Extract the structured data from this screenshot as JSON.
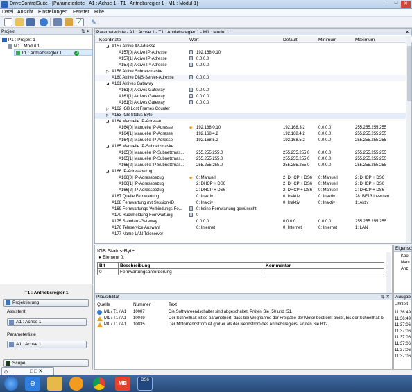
{
  "window": {
    "title": "DriveControlSuite  -  [Parameterliste - A1 : Achse 1 - T1 : Antriebsregler 1 - M1 : Modul 1]"
  },
  "menu": [
    "Datei",
    "Ansicht",
    "Einstellungen",
    "Fenster",
    "Hilfe"
  ],
  "toolbar": {
    "icons": [
      "new-file-icon",
      "open-folder-icon",
      "save-icon",
      "info-icon",
      "network-icon",
      "print-icon",
      "check-icon",
      "pen-icon"
    ]
  },
  "project_panel": {
    "title": "Projekt",
    "tree": [
      {
        "label": "P1 : Projekt 1",
        "level": 0
      },
      {
        "label": "M1 : Modul 1",
        "level": 1
      },
      {
        "label": "T1 : Antriebsregler 1",
        "level": 2,
        "selected": true,
        "badge": "0"
      }
    ]
  },
  "lower_left": {
    "title": "T1 : Antriebsregler 1",
    "projektierung": "Projektierung",
    "assistent_label": "Assistent",
    "assistent_button": "A1 : Achse 1",
    "parameterliste_label": "Parameterliste",
    "parameterliste_button": "A1 : Achse 1",
    "scope": "Scope"
  },
  "main_panel": {
    "title": "Parameterliste - A1 : Achse 1 - T1 : Antriebsregler 1 - M1 : Modul 1",
    "columns": [
      "Koordinate",
      "Wert",
      "Default",
      "Minimum",
      "Maximum"
    ],
    "rows": [
      {
        "k": "A157 Aktive IP-Adresse",
        "indent": 0,
        "exp": "◢"
      },
      {
        "k": "A157[0] Aktive IP-Adresse",
        "indent": 1,
        "lock": true,
        "v": "192.168.0.10"
      },
      {
        "k": "A157[1] Aktive IP-Adresse",
        "indent": 1,
        "lock": true,
        "v": "0.0.0.0"
      },
      {
        "k": "A157[2] Aktive IP-Adresse",
        "indent": 1,
        "lock": true,
        "v": "0.0.0.0"
      },
      {
        "k": "A158 Aktive Subnetzmaske",
        "indent": 0,
        "exp": "▷"
      },
      {
        "k": "A160 Aktive DNS-Server-Adresse",
        "indent": 0,
        "lock": true,
        "v": "0.0.0.0",
        "hl": true
      },
      {
        "k": "A161 Aktives Gateway",
        "indent": 0,
        "exp": "◢"
      },
      {
        "k": "A161[0] Aktives Gateway",
        "indent": 1,
        "lock": true,
        "v": "0.0.0.0"
      },
      {
        "k": "A161[1] Aktives Gateway",
        "indent": 1,
        "lock": true,
        "v": "0.0.0.0"
      },
      {
        "k": "A161[2] Aktives Gateway",
        "indent": 1,
        "lock": true,
        "v": "0.0.0.0"
      },
      {
        "k": "A162 IGB Lost Frames Counter",
        "indent": 0,
        "exp": "▷"
      },
      {
        "k": "A163 IGB Status-Byte",
        "indent": 0,
        "exp": "▷",
        "sel": true
      },
      {
        "k": "A164 Manuelle IP-Adresse",
        "indent": 0,
        "exp": "◢"
      },
      {
        "k": "A164[0] Manuelle IP-Adresse",
        "indent": 1,
        "star": true,
        "v": "192.168.0.10",
        "d": "192.168.3.2",
        "mn": "0.0.0.0",
        "mx": "255.255.255.255"
      },
      {
        "k": "A164[1] Manuelle IP-Adresse",
        "indent": 1,
        "v": "192.168.4.2",
        "d": "192.168.4.2",
        "mn": "0.0.0.0",
        "mx": "255.255.255.255"
      },
      {
        "k": "A164[2] Manuelle IP-Adresse",
        "indent": 1,
        "v": "192.168.5.2",
        "d": "192.168.5.2",
        "mn": "0.0.0.0",
        "mx": "255.255.255.255"
      },
      {
        "k": "A165 Manuelle IP-Subnetzmaske",
        "indent": 0,
        "exp": "◢"
      },
      {
        "k": "A165[0] Manuelle IP-Subnetzmas...",
        "indent": 1,
        "v": "255.255.255.0",
        "d": "255.255.255.0",
        "mn": "0.0.0.0",
        "mx": "255.255.255.255"
      },
      {
        "k": "A165[1] Manuelle IP-Subnetzmas...",
        "indent": 1,
        "v": "255.255.255.0",
        "d": "255.255.255.0",
        "mn": "0.0.0.0",
        "mx": "255.255.255.255"
      },
      {
        "k": "A165[2] Manuelle IP-Subnetzmas...",
        "indent": 1,
        "v": "255.255.255.0",
        "d": "255.255.255.0",
        "mn": "0.0.0.0",
        "mx": "255.255.255.255"
      },
      {
        "k": "A166 IP-Adressbezug",
        "indent": 0,
        "exp": "◢"
      },
      {
        "k": "A166[0] IP-Adressbezug",
        "indent": 1,
        "star": true,
        "v": "0: Manuell",
        "d": "2: DHCP + DS6",
        "mn": "0: Manuell",
        "mx": "2: DHCP + DS6"
      },
      {
        "k": "A166[1] IP-Adressbezug",
        "indent": 1,
        "v": "2: DHCP + DS6",
        "d": "2: DHCP + DS6",
        "mn": "0: Manuell",
        "mx": "2: DHCP + DS6"
      },
      {
        "k": "A166[2] IP-Adressbezug",
        "indent": 1,
        "v": "2: DHCP + DS6",
        "d": "2: DHCP + DS6",
        "mn": "0: Manuell",
        "mx": "2: DHCP + DS6"
      },
      {
        "k": "A167 Quelle Fernwartung",
        "indent": 0,
        "v": "0: Inaktiv",
        "d": "0: Inaktiv",
        "mn": "0: Inaktiv",
        "mx": "28: BE13 invertiert"
      },
      {
        "k": "A168 Fernwartung mit Session-ID",
        "indent": 0,
        "v": "0: Inaktiv",
        "d": "0: Inaktiv",
        "mn": "0: Inaktiv",
        "mx": "1: Aktiv"
      },
      {
        "k": "A169 Fernwartungs-Verbindungs-Fo...",
        "indent": 0,
        "lock": true,
        "v": "0: keine Fernwartung gewünscht"
      },
      {
        "k": "A170 Rückmeldung Fernwartung",
        "indent": 0,
        "lock": true,
        "v": "0"
      },
      {
        "k": "A175 Standard-Gateway",
        "indent": 0,
        "v": "0.0.0.0",
        "d": "0.0.0.0",
        "mn": "0.0.0.0",
        "mx": "255.255.255.255"
      },
      {
        "k": "A176 Teleservice Auswahl",
        "indent": 0,
        "v": "0: Internet",
        "d": "0: Internet",
        "mn": "0: Internet",
        "mx": "1: LAN"
      },
      {
        "k": "A177 Name LAN Teleserver",
        "indent": 0
      }
    ]
  },
  "detail": {
    "title": "IGB Status-Byte",
    "element": "Element 0:",
    "headers": [
      "Bit",
      "Beschreibung",
      "Kommentar"
    ],
    "rows": [
      [
        "0",
        "Fernwartungsanforderung",
        ""
      ]
    ]
  },
  "properties": {
    "title": "Eigensc",
    "lines": [
      "Koo",
      "Nam",
      "Anz"
    ]
  },
  "plausibility": {
    "title": "Plausibilität",
    "headers": [
      "Quelle",
      "Nummer",
      "Text"
    ],
    "rows": [
      {
        "src": "M1 / T1 / A1",
        "num": "10007",
        "text": "Die Softwareendschalter sind abgeschaltet. Prüfen Sie I50 und I51.",
        "type": "info"
      },
      {
        "src": "M1 / T1 / A1",
        "num": "10049",
        "text": "Der Schnellhalt ist so parametriert, dass bei Wegnahme der Freigabe der Motor bestromt bleibt, bis der Schnellhalt b",
        "type": "warn"
      },
      {
        "src": "M1 / T1 / A1",
        "num": "10035",
        "text": "Der Motornennstrom ist größer als der Nennstrom des Antriebsreglers. Prüfen Sie B12.",
        "type": "warn"
      }
    ]
  },
  "output": {
    "title": "Ausgabe",
    "header": "Uhrzeit",
    "times": [
      "11:36:49",
      "11:36:49",
      "11:37:06",
      "11:37:06",
      "11:37:06",
      "11:37:06",
      "11:37:06",
      "11:37:06"
    ]
  },
  "taskbar": {
    "apps": [
      "start-orb-icon",
      "internet-explorer-icon",
      "explorer-folder-icon",
      "media-player-icon",
      "chrome-icon",
      "mb-app-icon",
      "drivecontrolsuite-icon"
    ],
    "ds6_label": "DS6"
  }
}
